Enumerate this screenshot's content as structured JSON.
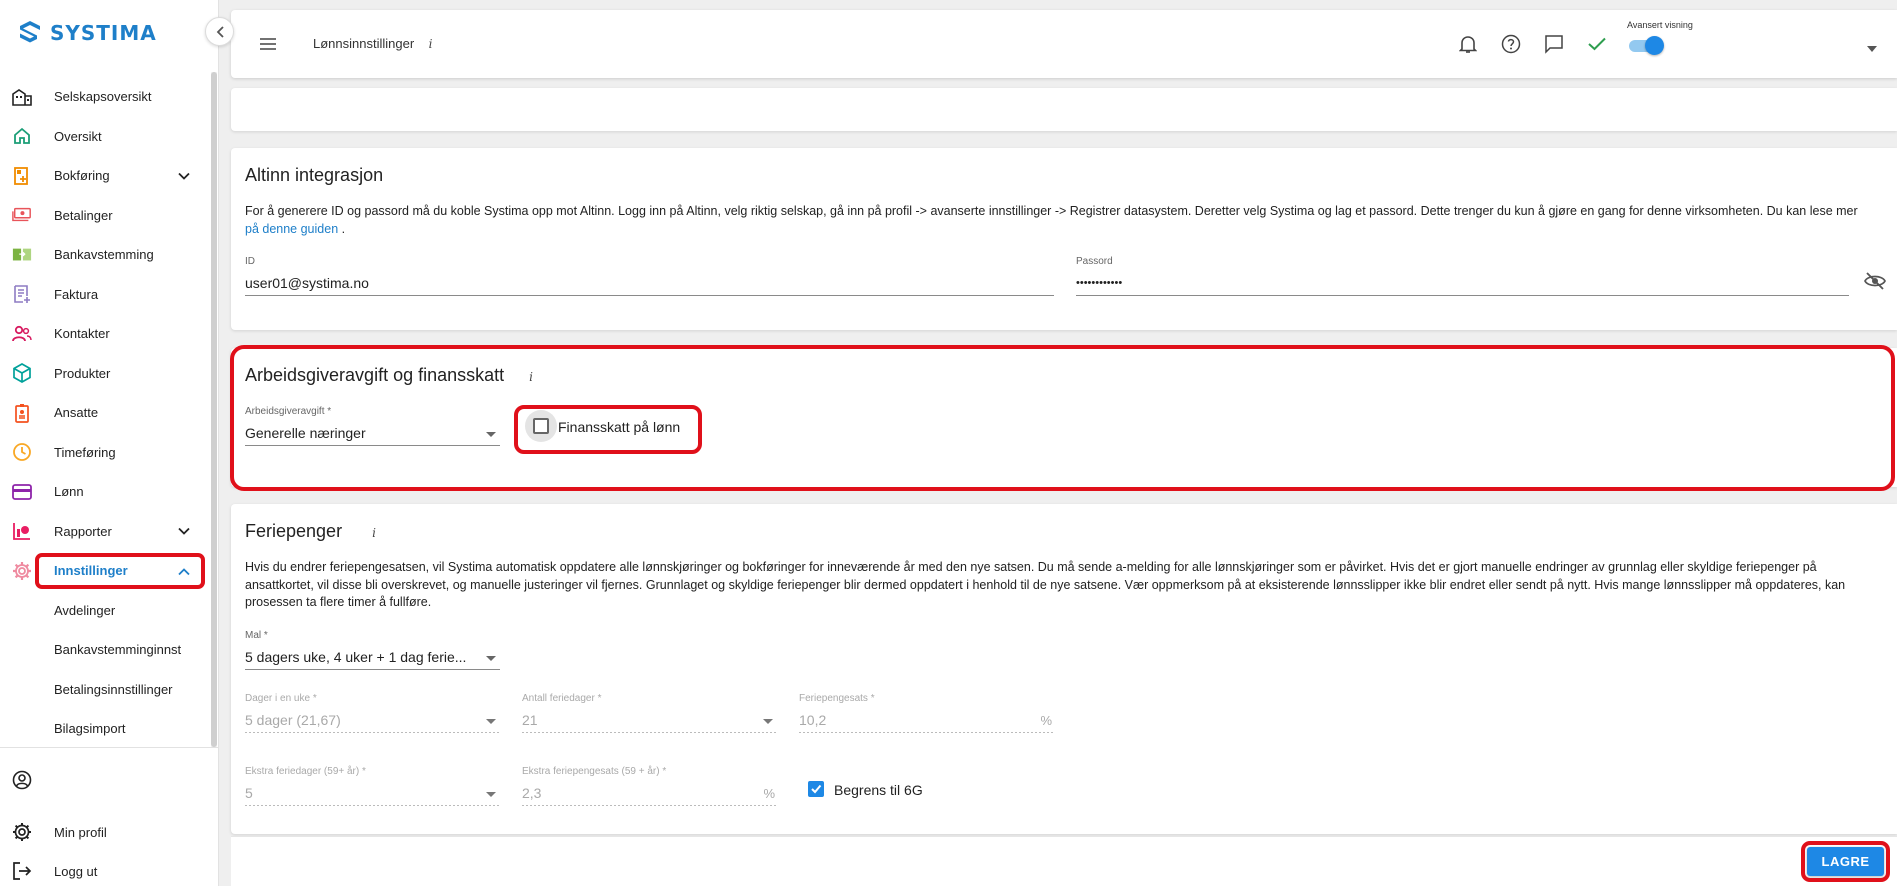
{
  "app": {
    "brand": "SYSTIMA",
    "accent": "#1e7fc9",
    "highlight": "#e0101a"
  },
  "sidebar": {
    "items": [
      {
        "label": "Selskapsoversikt",
        "icon": "building-icon"
      },
      {
        "label": "Oversikt",
        "icon": "home-icon"
      },
      {
        "label": "Bokføring",
        "icon": "bookkeeping-icon",
        "expandable": true
      },
      {
        "label": "Betalinger",
        "icon": "payment-icon"
      },
      {
        "label": "Bankavstemming",
        "icon": "bank-reconciliation-icon"
      },
      {
        "label": "Faktura",
        "icon": "invoice-icon"
      },
      {
        "label": "Kontakter",
        "icon": "contacts-icon"
      },
      {
        "label": "Produkter",
        "icon": "product-icon"
      },
      {
        "label": "Ansatte",
        "icon": "employee-icon"
      },
      {
        "label": "Timeføring",
        "icon": "clock-icon"
      },
      {
        "label": "Lønn",
        "icon": "salary-icon"
      },
      {
        "label": "Rapporter",
        "icon": "reports-icon",
        "expandable": true
      },
      {
        "label": "Innstillinger",
        "icon": "settings-icon",
        "expandable": true,
        "active": true
      }
    ],
    "sub_items": [
      "Avdelinger",
      "Bankavstemminginnst",
      "Betalingsinnstillinger",
      "Bilagsimport"
    ],
    "bottom": {
      "profile": "Min profil",
      "logout": "Logg ut"
    }
  },
  "topbar": {
    "title": "Lønnsinnstillinger",
    "info": "i",
    "advanced_view_label": "Avansert visning",
    "advanced_view_on": true
  },
  "altinn": {
    "title": "Altinn integrasjon",
    "description": "For å generere ID og passord må du koble Systima opp mot Altinn. Logg inn på Altinn, velg riktig selskap, gå inn på profil -> avanserte innstillinger -> Registrer datasystem. Deretter velg Systima og lag et passord. Dette trenger du kun å gjøre en gang for denne virksomheten. Du kan lese mer",
    "link_text": "på denne guiden",
    "after_link": " .",
    "id_label": "ID",
    "id_value": "user01@systima.no",
    "password_label": "Passord",
    "password_value": "••••••••••••"
  },
  "employer_tax": {
    "title": "Arbeidsgiveravgift og finansskatt",
    "info": "i",
    "select_label": "Arbeidsgiveravgift *",
    "select_value": "Generelle næringer",
    "finance_tax_label": "Finansskatt på lønn",
    "finance_tax_checked": false
  },
  "holiday": {
    "title": "Feriepenger",
    "info": "i",
    "description": "Hvis du endrer feriepengesatsen, vil Systima automatisk oppdatere alle lønnskjøringer og bokføringer for inneværende år med den nye satsen. Du må sende a-melding for alle lønnskjøringer som er påvirket. Hvis det er gjort manuelle endringer av grunnlag eller skyldige feriepenger på ansattkortet, vil disse bli overskrevet, og manuelle justeringer vil fjernes. Grunnlaget og skyldige feriepenger blir dermed oppdatert i henhold til de nye satsene. Vær oppmerksom på at eksisterende lønnsslipper ikke blir endret eller sendt på nytt. Hvis mange lønnsslipper må oppdateres, kan prosessen ta flere timer å fullføre.",
    "template_label": "Mal *",
    "template_value": "5 dagers uke, 4 uker + 1 dag ferie...",
    "days_week_label": "Dager i en uke *",
    "days_week_value": "5 dager (21,67)",
    "num_days_label": "Antall feriedager *",
    "num_days_value": "21",
    "rate_label": "Feriepengesats *",
    "rate_value": "10,2",
    "rate_suffix": "%",
    "extra_days_label": "Ekstra feriedager (59+ år) *",
    "extra_days_value": "5",
    "extra_rate_label": "Ekstra feriepengesats (59 + år) *",
    "extra_rate_value": "2,3",
    "extra_rate_suffix": "%",
    "limit_label": "Begrens til 6G",
    "limit_checked": true
  },
  "actions": {
    "save": "LAGRE"
  }
}
